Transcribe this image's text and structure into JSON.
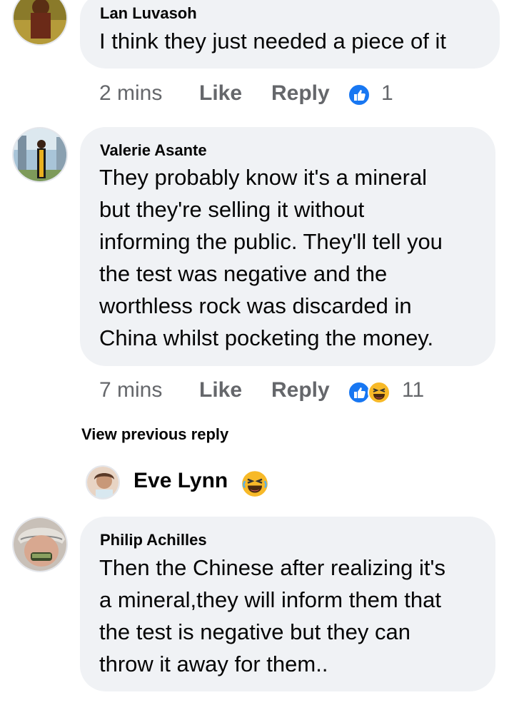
{
  "comments": [
    {
      "author": "Lan Luvasoh",
      "lines": [
        "I think they just needed a piece of it"
      ],
      "time": "2 mins",
      "like_label": "Like",
      "reply_label": "Reply",
      "reaction_count": "1",
      "reactions": [
        "like-icon"
      ]
    },
    {
      "author": "Valerie Asante",
      "lines": [
        "They probably know it's a mineral",
        "but they're selling it without",
        "informing the public. They'll tell you",
        "the test was negative and the",
        "worthless rock was discarded in",
        "China whilst pocketing the money."
      ],
      "time": "7 mins",
      "like_label": "Like",
      "reply_label": "Reply",
      "reaction_count": "11",
      "reactions": [
        "like-icon",
        "haha-icon"
      ]
    },
    {
      "author": "Philip Achilles",
      "lines": [
        "Then the Chinese after realizing it's",
        "a mineral,they will inform them that",
        "the test is negative but they can",
        "throw it away for them.."
      ]
    }
  ],
  "view_previous_reply": "View previous reply",
  "reply_preview": {
    "author": "Eve Lynn",
    "reaction": "haha-icon"
  },
  "colors": {
    "bubble": "#f0f2f5",
    "meta_text": "#65676b",
    "like_blue": "#1877f2",
    "haha_yellow": "#f7b928"
  }
}
